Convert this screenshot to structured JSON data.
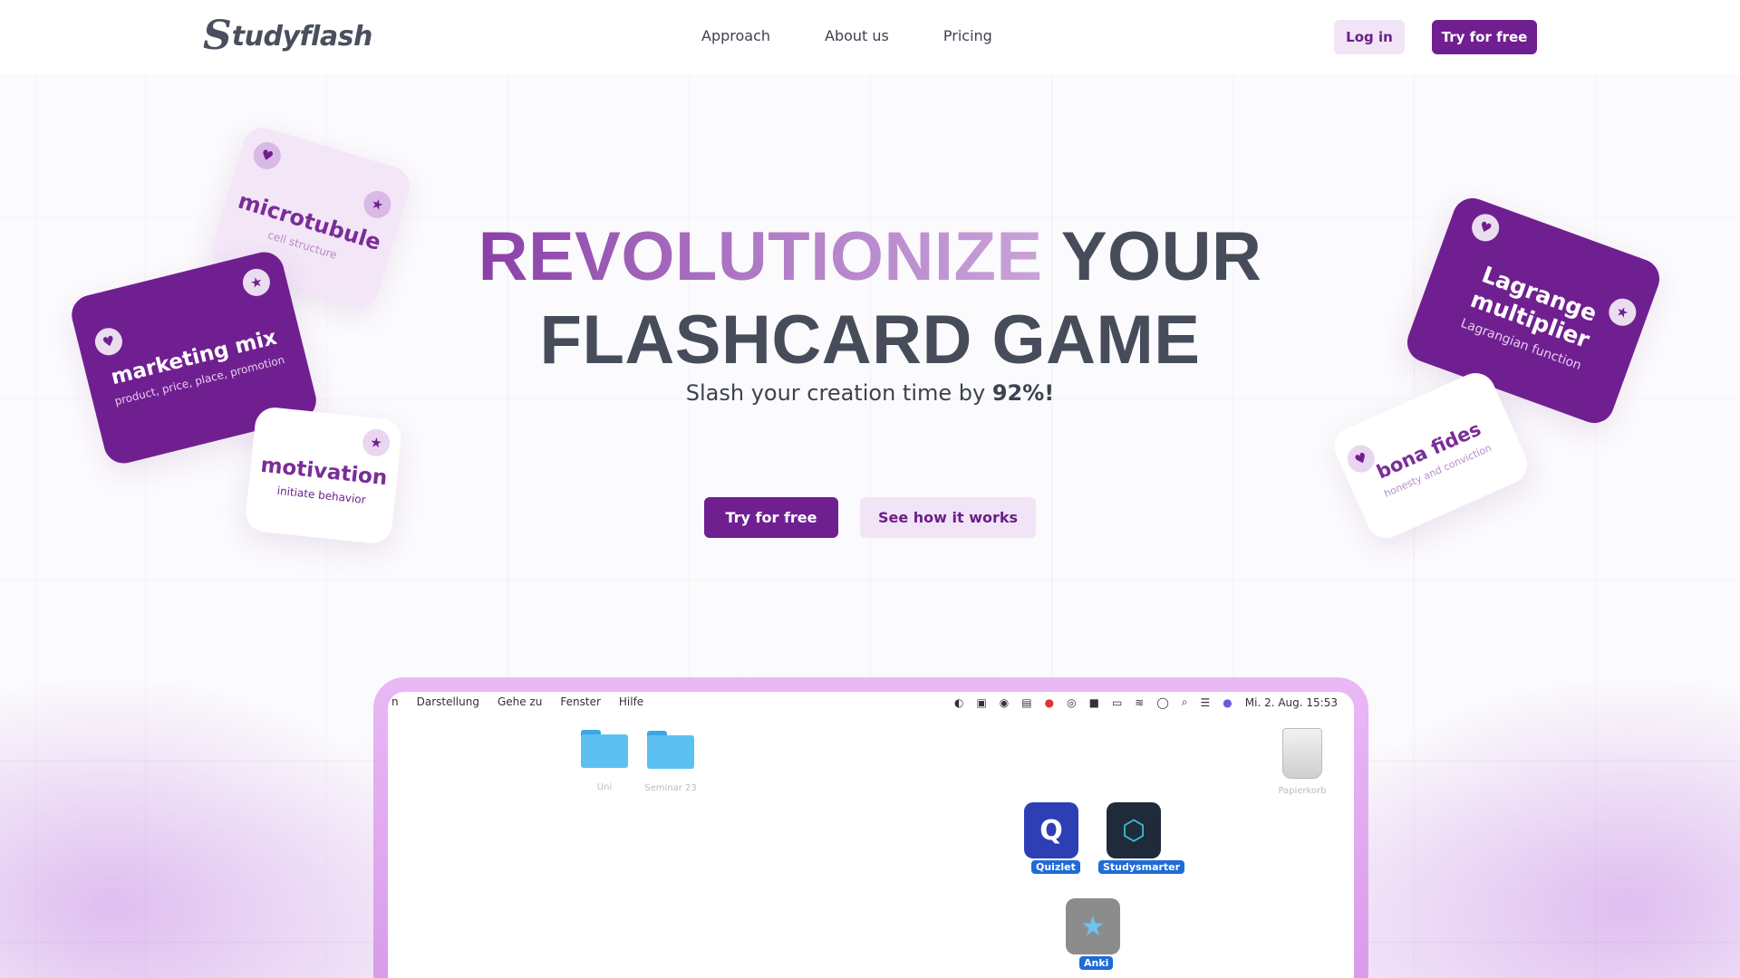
{
  "nav": {
    "logo_mark": "S",
    "logo_text": "tudyflash",
    "links": [
      "Approach",
      "About us",
      "Pricing"
    ],
    "login_label": "Log in",
    "try_label": "Try for free"
  },
  "hero": {
    "title_highlight": "REVOLUTIONIZE",
    "title_rest_1": "YOUR",
    "title_line_2": "FLASHCARD GAME",
    "subtitle_prefix": "Slash your creation time by ",
    "subtitle_value": "92%",
    "subtitle_suffix": "!",
    "try_label": "Try for free",
    "see_label": "See how it works"
  },
  "cards": {
    "microtubule": {
      "term": "microtubule",
      "definition": "cell structure"
    },
    "marketing": {
      "term": "marketing mix",
      "definition": "product, price, place, promotion"
    },
    "motivation": {
      "term": "motivation",
      "definition": "initiate behavior"
    },
    "lagrange": {
      "term": "Lagrange multiplier",
      "definition": "Lagrangian function"
    },
    "bona": {
      "term": "bona fides",
      "definition": "honesty and conviction"
    }
  },
  "desktop": {
    "menus": [
      "n",
      "Darstellung",
      "Gehe zu",
      "Fenster",
      "Hilfe"
    ],
    "clock": "Mi. 2. Aug.  15:53",
    "folder_1_label": "Uni",
    "folder_2_label": "Seminar 23",
    "trash_label": "Papierkorb",
    "apps": {
      "quizlet": "Quizlet",
      "studysmarter": "Studysmarter",
      "anki": "Anki"
    }
  },
  "colors": {
    "brand": "#701f91",
    "brand_light": "#f1e4f6",
    "text_dark": "#464c5a"
  }
}
